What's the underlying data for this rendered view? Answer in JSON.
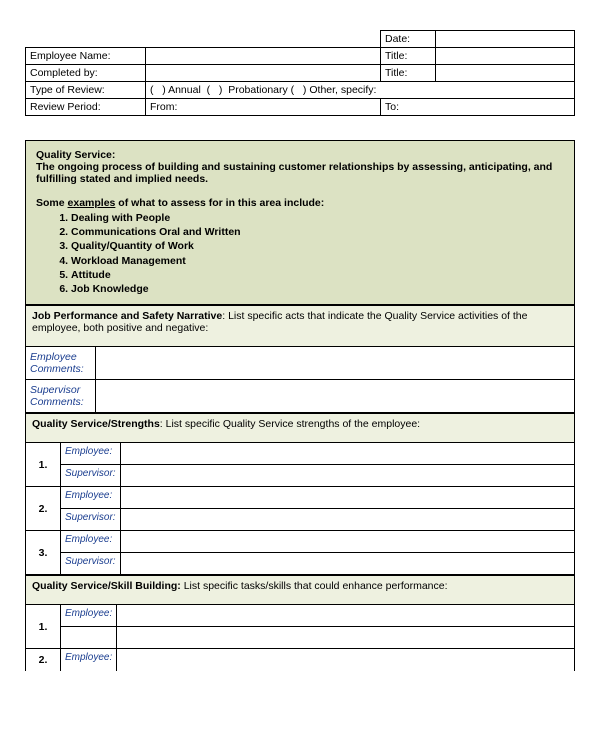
{
  "header": {
    "date_label": "Date:",
    "employee_name_label": "Employee Name:",
    "title_label": "Title:",
    "completed_by_label": "Completed by:",
    "type_of_review_label": "Type of Review:",
    "annual_label": "Annual",
    "probationary_label": "Probationary",
    "other_specify_label": "Other, specify:",
    "review_period_label": "Review Period:",
    "from_label": "From:",
    "to_label": "To:"
  },
  "quality": {
    "heading": "Quality Service:",
    "definition": "The ongoing process of building and sustaining customer relationships by assessing, anticipating, and fulfilling stated and implied needs.",
    "examples_intro_pre": "Some ",
    "examples_intro_u": "examples",
    "examples_intro_post": " of what to assess for in this area include:",
    "examples": [
      "Dealing with People",
      "Communications Oral and Written",
      "Quality/Quantity of Work",
      "Workload Management",
      "Attitude",
      "Job Knowledge"
    ]
  },
  "narrative": {
    "title": "Job Performance and Safety Narrative",
    "desc": ": List specific acts that indicate the Quality Service activities of the employee, both positive and negative:",
    "employee_comments_label": "Employee Comments:",
    "supervisor_comments_label": "Supervisor Comments:"
  },
  "strengths": {
    "title": "Quality Service/Strengths",
    "desc": ": List specific Quality Service strengths of the employee:",
    "rows": [
      "1.",
      "2.",
      "3."
    ],
    "employee_label": "Employee:",
    "supervisor_label": "Supervisor:"
  },
  "skill": {
    "title": "Quality Service/Skill Building:",
    "desc": " List specific tasks/skills that could enhance performance:",
    "rows": [
      "1.",
      "2."
    ],
    "employee_label": "Employee:"
  }
}
